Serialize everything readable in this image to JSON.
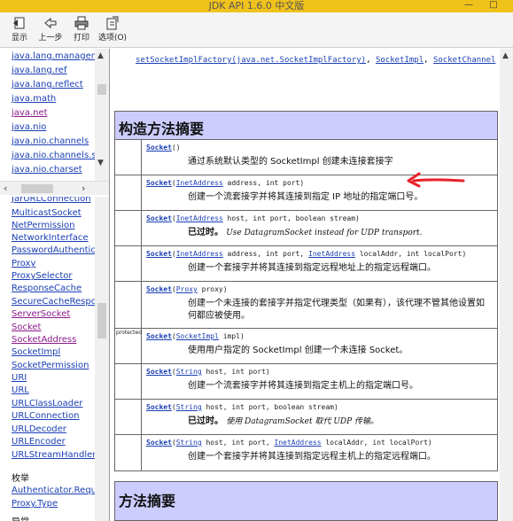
{
  "window": {
    "title": "JDK API 1.6.0 中文版",
    "minimize": "—",
    "maximize": "□"
  },
  "toolbar": [
    {
      "label": "显示",
      "icon": "show-icon"
    },
    {
      "label": "上一步",
      "icon": "back-icon"
    },
    {
      "label": "打印",
      "icon": "print-icon"
    },
    {
      "label": "选项(O)",
      "icon": "options-icon"
    }
  ],
  "packages": [
    "java.lang.management",
    "java.lang.ref",
    "java.lang.reflect",
    "java.math",
    "java.net",
    "java.nio",
    "java.nio.channels",
    "java.nio.channels.spi",
    "java.nio.charset"
  ],
  "classes": [
    "JarURLConnection",
    "MulticastSocket",
    "NetPermission",
    "NetworkInterface",
    "PasswordAuthentication",
    "Proxy",
    "ProxySelector",
    "ResponseCache",
    "SecureCacheResponse",
    "ServerSocket",
    "Socket",
    "SocketAddress",
    "SocketImpl",
    "SocketPermission",
    "URI",
    "URL",
    "URLClassLoader",
    "URLConnection",
    "URLDecoder",
    "URLEncoder",
    "URLStreamHandler"
  ],
  "enum_heading": "枚举",
  "enums": [
    "Authenticator.RequestorType",
    "Proxy.Type"
  ],
  "enum_partial": "异常",
  "seealso": {
    "method": "setSocketImplFactory(java.net.SocketImplFactory)",
    "sep": ", ",
    "link1": "SocketImpl",
    "link2": "SocketChannel"
  },
  "constructor_summary": {
    "title": "构造方法摘要",
    "rows": [
      {
        "modifier": "",
        "name": "Socket",
        "params": "()",
        "desc": "通过系统默认类型的 SocketImpl 创建未连接套接字"
      },
      {
        "modifier": "",
        "name": "Socket",
        "params_pre": "(",
        "ptype": "InetAddress",
        "params_post": " address, int port)",
        "desc": "创建一个流套接字并将其连接到指定 IP 地址的指定端口号。"
      },
      {
        "modifier": "",
        "name": "Socket",
        "params_pre": "(",
        "ptype": "InetAddress",
        "params_post": " host, int port, boolean stream)",
        "dep": "已过时。",
        "desc_italic": "Use DatagramSocket instead for UDP transport."
      },
      {
        "modifier": "",
        "name": "Socket",
        "params_pre": "(",
        "ptype": "InetAddress",
        "params_post": " address, int port, ",
        "ptype2": "InetAddress",
        "params_post2": " localAddr, int localPort)",
        "desc": "创建一个套接字并将其连接到指定远程地址上的指定远程端口。"
      },
      {
        "modifier": "",
        "name": "Socket",
        "params_pre": "(",
        "ptype": "Proxy",
        "params_post": " proxy)",
        "desc": "创建一个未连接的套接字并指定代理类型（如果有），该代理不管其他设置如何都应被使用。"
      },
      {
        "modifier": "protected",
        "name": "Socket",
        "params_pre": "(",
        "ptype": "SocketImpl",
        "params_post": " impl)",
        "desc": "使用用户指定的 SocketImpl 创建一个未连接 Socket。"
      },
      {
        "modifier": "",
        "name": "Socket",
        "params_pre": "(",
        "ptype": "String",
        "params_post": " host, int port)",
        "desc": "创建一个流套接字并将其连接到指定主机上的指定端口号。"
      },
      {
        "modifier": "",
        "name": "Socket",
        "params_pre": "(",
        "ptype": "String",
        "params_post": " host, int port, boolean stream)",
        "dep": "已过时。",
        "desc_italic": "使用 DatagramSocket 取代 UDP 传输。"
      },
      {
        "modifier": "",
        "name": "Socket",
        "params_pre": "(",
        "ptype": "String",
        "params_post": " host, int port, ",
        "ptype2": "InetAddress",
        "params_post2": " localAddr, int localPort)",
        "desc": "创建一个套接字并将其连接到指定远程主机上的指定远程端口。"
      }
    ]
  },
  "method_summary": {
    "title": "方法摘要"
  },
  "colors": {
    "accent_header": "#ccccff",
    "link": "#1a3fb5",
    "visited": "#8a1a8a",
    "annotation_arrow": "#e8222a",
    "titlebar": "#f0c21c"
  }
}
